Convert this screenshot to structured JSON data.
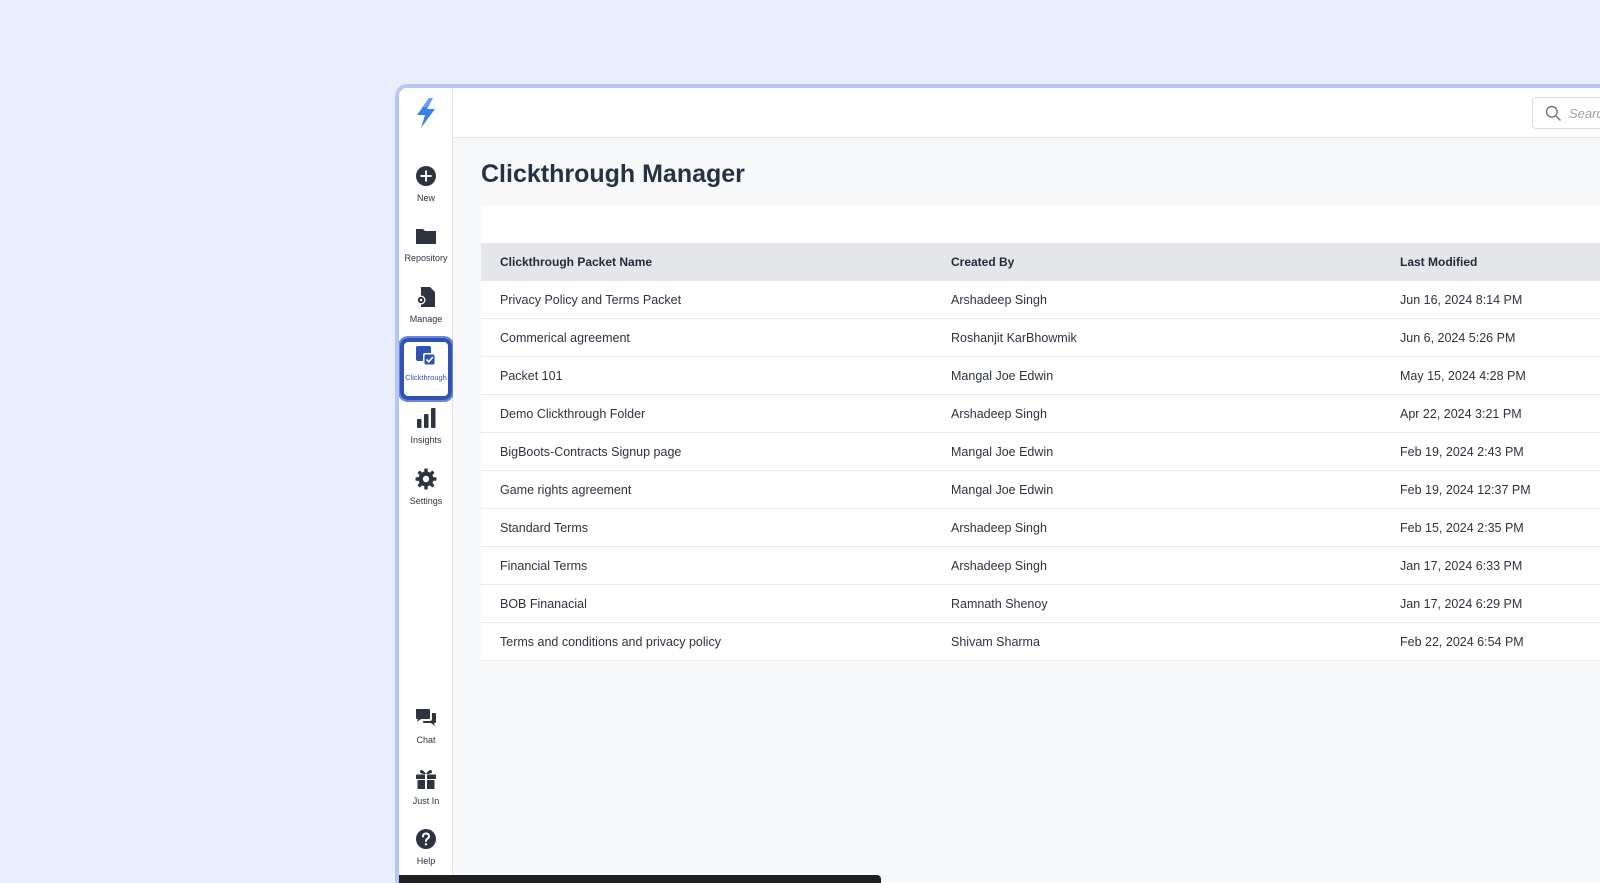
{
  "sidebar": {
    "items": [
      {
        "label": "New",
        "icon": "plus-circle-icon"
      },
      {
        "label": "Repository",
        "icon": "folder-icon"
      },
      {
        "label": "Manage",
        "icon": "document-gear-icon"
      },
      {
        "label": "Clickthrough",
        "icon": "clickthrough-icon"
      },
      {
        "label": "Insights",
        "icon": "bar-chart-icon"
      },
      {
        "label": "Settings",
        "icon": "gear-icon"
      },
      {
        "label": "Chat",
        "icon": "chat-icon"
      },
      {
        "label": "Just In",
        "icon": "gift-icon"
      },
      {
        "label": "Help",
        "icon": "help-icon"
      }
    ],
    "active": "Clickthrough",
    "accent": "#2f53b5"
  },
  "search": {
    "placeholder": "Search"
  },
  "page": {
    "title": "Clickthrough Manager"
  },
  "table": {
    "headers": [
      "Clickthrough Packet Name",
      "Created By",
      "Last Modified"
    ],
    "rows": [
      [
        "Privacy Policy and Terms Packet",
        "Arshadeep Singh",
        "Jun 16, 2024 8:14 PM"
      ],
      [
        "Commerical agreement",
        "Roshanjit KarBhowmik",
        "Jun 6, 2024 5:26 PM"
      ],
      [
        "Packet 101",
        "Mangal Joe Edwin",
        "May 15, 2024 4:28 PM"
      ],
      [
        "Demo Clickthrough Folder",
        "Arshadeep Singh",
        "Apr 22, 2024 3:21 PM"
      ],
      [
        "BigBoots-Contracts Signup page",
        "Mangal Joe Edwin",
        "Feb 19, 2024 2:43 PM"
      ],
      [
        "Game rights agreement",
        "Mangal Joe Edwin",
        "Feb 19, 2024 12:37 PM"
      ],
      [
        "Standard Terms",
        "Arshadeep Singh",
        "Feb 15, 2024 2:35 PM"
      ],
      [
        "Financial Terms",
        "Arshadeep Singh",
        "Jan 17, 2024 6:33 PM"
      ],
      [
        "BOB Finanacial",
        "Ramnath Shenoy",
        "Jan 17, 2024 6:29 PM"
      ],
      [
        "Terms and conditions and privacy policy",
        "Shivam Sharma",
        "Feb 22, 2024 6:54 PM"
      ]
    ]
  }
}
